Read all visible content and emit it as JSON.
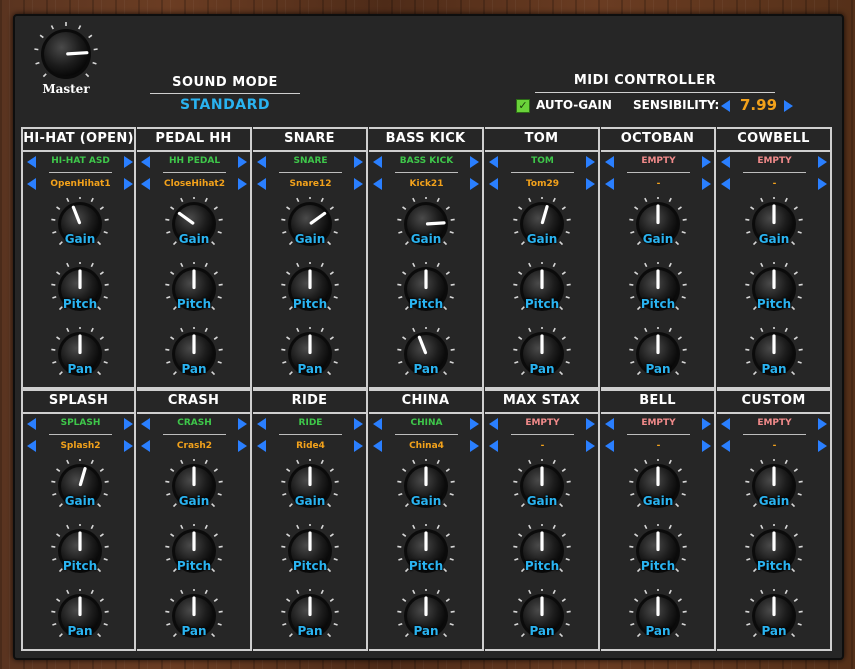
{
  "master": {
    "label": "Master",
    "value": 0.82
  },
  "sound_mode": {
    "title": "SOUND MODE",
    "value": "STANDARD"
  },
  "midi": {
    "title": "MIDI CONTROLLER",
    "auto_gain_label": "AUTO-GAIN",
    "auto_gain_checked": true,
    "sensibility_label": "SENSIBILITY:",
    "sensibility_value": "7.99"
  },
  "knob_labels": {
    "gain": "Gain",
    "pitch": "Pitch",
    "pan": "Pan"
  },
  "instruments": [
    {
      "title": "HI-HAT (OPEN)",
      "kit": "HI-HAT ASD",
      "kit_color": "green",
      "sample": "OpenHihat1",
      "gain": 0.42,
      "pitch": 0.5,
      "pan": 0.5
    },
    {
      "title": "PEDAL HH",
      "kit": "HH PEDAL",
      "kit_color": "green",
      "sample": "CloseHihat2",
      "gain": 0.3,
      "pitch": 0.5,
      "pan": 0.5
    },
    {
      "title": "SNARE",
      "kit": "SNARE",
      "kit_color": "green",
      "sample": "Snare12",
      "gain": 0.7,
      "pitch": 0.5,
      "pan": 0.5
    },
    {
      "title": "BASS KICK",
      "kit": "BASS KICK",
      "kit_color": "green",
      "sample": "Kick21",
      "gain": 0.82,
      "pitch": 0.5,
      "pan": 0.42
    },
    {
      "title": "TOM",
      "kit": "TOM",
      "kit_color": "green",
      "sample": "Tom29",
      "gain": 0.56,
      "pitch": 0.5,
      "pan": 0.5
    },
    {
      "title": "OCTOBAN",
      "kit": "EMPTY",
      "kit_color": "red",
      "sample": "-",
      "gain": 0.5,
      "pitch": 0.5,
      "pan": 0.5
    },
    {
      "title": "COWBELL",
      "kit": "EMPTY",
      "kit_color": "red",
      "sample": "-",
      "gain": 0.5,
      "pitch": 0.5,
      "pan": 0.5
    },
    {
      "title": "SPLASH",
      "kit": "SPLASH",
      "kit_color": "green",
      "sample": "Splash2",
      "gain": 0.56,
      "pitch": 0.5,
      "pan": 0.5
    },
    {
      "title": "CRASH",
      "kit": "CRASH",
      "kit_color": "green",
      "sample": "Crash2",
      "gain": 0.5,
      "pitch": 0.5,
      "pan": 0.5
    },
    {
      "title": "RIDE",
      "kit": "RIDE",
      "kit_color": "green",
      "sample": "Ride4",
      "gain": 0.5,
      "pitch": 0.5,
      "pan": 0.5
    },
    {
      "title": "CHINA",
      "kit": "CHINA",
      "kit_color": "green",
      "sample": "China4",
      "gain": 0.5,
      "pitch": 0.5,
      "pan": 0.5
    },
    {
      "title": "MAX STAX",
      "kit": "EMPTY",
      "kit_color": "red",
      "sample": "-",
      "gain": 0.5,
      "pitch": 0.5,
      "pan": 0.5
    },
    {
      "title": "BELL",
      "kit": "EMPTY",
      "kit_color": "red",
      "sample": "-",
      "gain": 0.5,
      "pitch": 0.5,
      "pan": 0.5
    },
    {
      "title": "CUSTOM",
      "kit": "EMPTY",
      "kit_color": "red",
      "sample": "-",
      "gain": 0.5,
      "pitch": 0.5,
      "pan": 0.5
    }
  ],
  "colors": {
    "accent_blue": "#2ab3f0",
    "arrow_blue": "#2a7fff",
    "sample_orange": "#f3a21b",
    "kit_green": "#3ec74a",
    "kit_empty_red": "#f18a8a"
  },
  "icons": {
    "prev": "triangle-left-icon",
    "next": "triangle-right-icon",
    "check": "checkbox-checked-icon"
  }
}
